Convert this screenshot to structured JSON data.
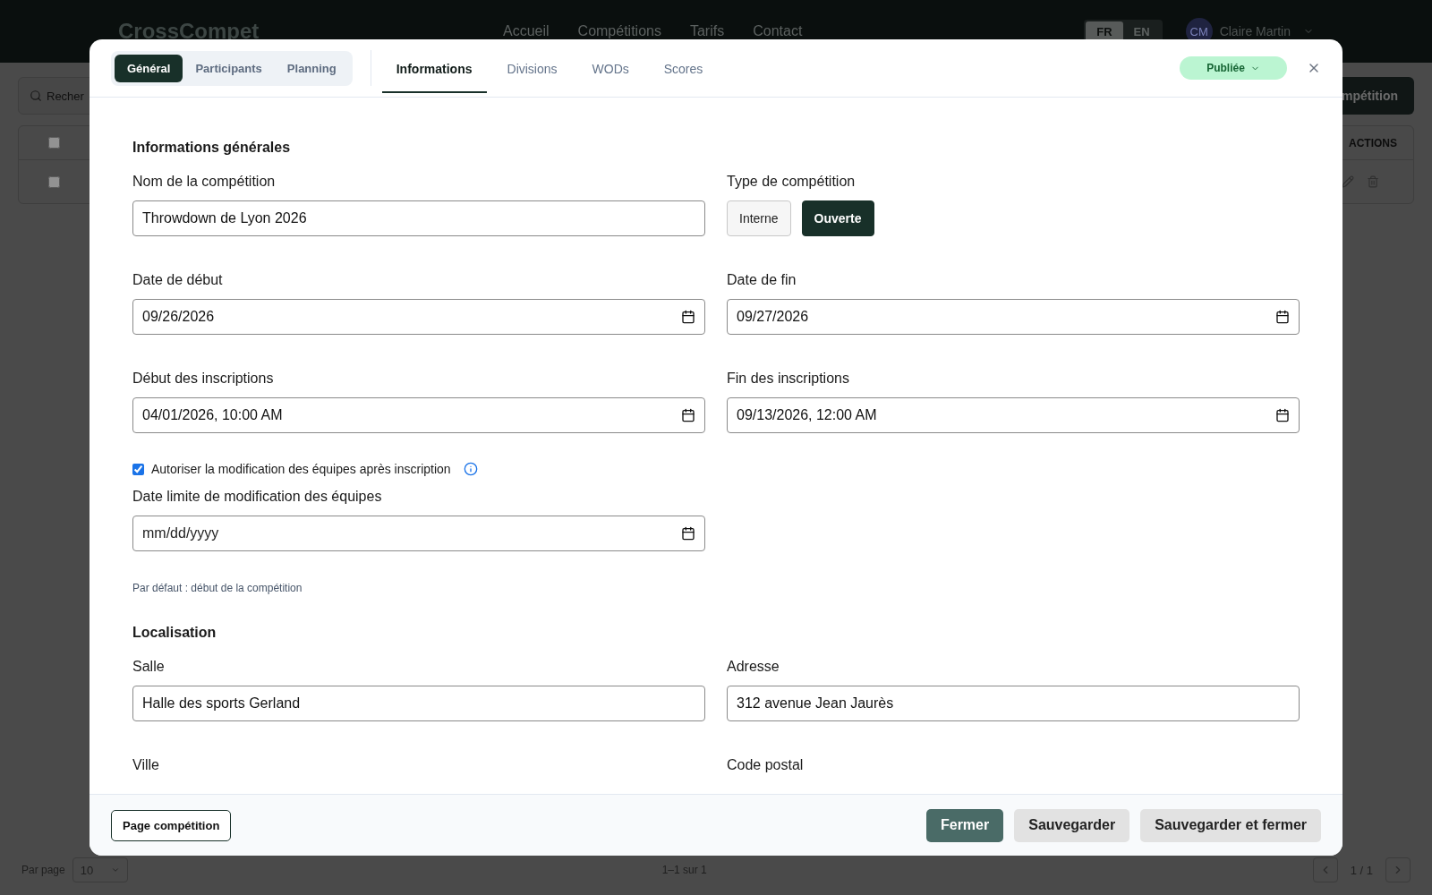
{
  "app": {
    "logo": "CrossCompet",
    "nav": [
      "Accueil",
      "Compétitions",
      "Tarifs",
      "Contact"
    ],
    "languages": [
      {
        "label": "FR",
        "selected": true
      },
      {
        "label": "EN",
        "selected": false
      }
    ],
    "user": {
      "initials": "CM",
      "name": "Claire Martin"
    }
  },
  "background": {
    "search_placeholder": "Recher",
    "create_button": "mpétition",
    "table_header": "ACTIONS",
    "header_checked": false,
    "row_checked": false
  },
  "pagination": {
    "per_page_label": "Par page",
    "per_page": "10",
    "range": "1–1 sur 1",
    "page": "1 / 1"
  },
  "modal": {
    "group_tabs": [
      {
        "label": "Général",
        "selected": true
      },
      {
        "label": "Participants",
        "selected": false
      },
      {
        "label": "Planning",
        "selected": false
      }
    ],
    "tabs": [
      {
        "label": "Informations",
        "selected": true
      },
      {
        "label": "Divisions",
        "selected": false
      },
      {
        "label": "WODs",
        "selected": false
      },
      {
        "label": "Scores",
        "selected": false
      }
    ],
    "status": "Publiée",
    "items": [
      {
        "kind": "heading",
        "text": "Informations générales"
      },
      {
        "kind": "pair",
        "fields": [
          {
            "kind": "text",
            "label": "Nom de la compétition",
            "value": "Throwdown de Lyon 2026"
          },
          {
            "kind": "choice",
            "label": "Type de compétition",
            "options": [
              {
                "label": "Interne",
                "selected": false
              },
              {
                "label": "Ouverte",
                "selected": true
              }
            ]
          }
        ]
      },
      {
        "kind": "pair",
        "fields": [
          {
            "kind": "date",
            "label": "Date de début",
            "value": "09/26/2026"
          },
          {
            "kind": "date",
            "label": "Date de fin",
            "value": "09/27/2026"
          }
        ]
      },
      {
        "kind": "pair",
        "fields": [
          {
            "kind": "date",
            "label": "Début des inscriptions",
            "value": "04/01/2026, 10:00 AM"
          },
          {
            "kind": "date",
            "label": "Fin des inscriptions",
            "value": "09/13/2026, 12:00 AM"
          }
        ]
      },
      {
        "kind": "checkbox",
        "label": "Autoriser la modification des équipes après inscription",
        "checked": true
      },
      {
        "kind": "pair",
        "fields": [
          {
            "kind": "date",
            "label": "Date limite de modification des équipes",
            "placeholder": "mm/dd/yyyy"
          }
        ]
      },
      {
        "kind": "hint",
        "text": "Par défaut : début de la compétition"
      },
      {
        "kind": "heading",
        "text": "Localisation"
      },
      {
        "kind": "pair",
        "fields": [
          {
            "kind": "text",
            "label": "Salle",
            "value": "Halle des sports Gerland"
          },
          {
            "kind": "text",
            "label": "Adresse",
            "value": "312 avenue Jean Jaurès"
          }
        ]
      },
      {
        "kind": "pair",
        "fields": [
          {
            "kind": "text",
            "label": "Ville"
          },
          {
            "kind": "text",
            "label": "Code postal"
          }
        ]
      }
    ],
    "footer": {
      "left": "Page compétition",
      "buttons": [
        {
          "label": "Fermer",
          "kind": "primary"
        },
        {
          "label": "Sauvegarder",
          "kind": "secondary"
        },
        {
          "label": "Sauvegarder et fermer",
          "kind": "secondary"
        }
      ]
    }
  }
}
